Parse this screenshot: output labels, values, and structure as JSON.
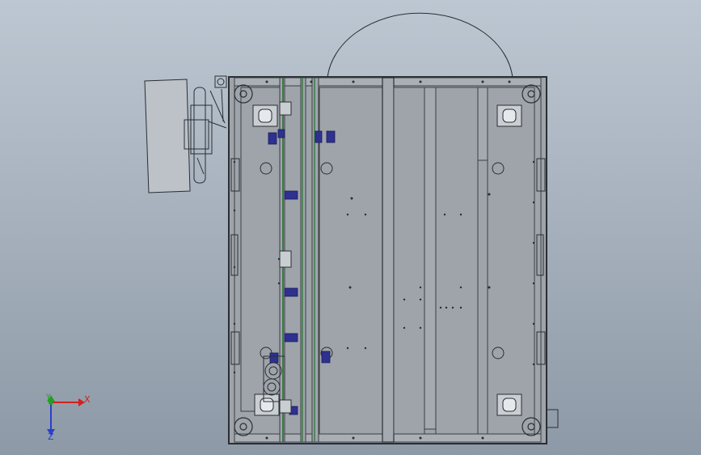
{
  "viewport": {
    "background_top": "#bdc7d2",
    "background_bottom": "#8d99a6"
  },
  "model": {
    "frame_color": "#2a2e33",
    "panel_fill": "#9ea4aa",
    "line_color": "#3b3f44",
    "cover_fill": "#bcc2c8",
    "bracket_color": "#2e3190",
    "strip_color": "#3f7a46"
  },
  "triad": {
    "x_label": "X",
    "y_label": "Y",
    "z_label": "Z",
    "x_color": "#d42020",
    "y_color": "#22a022",
    "z_color": "#2a3fd0"
  }
}
